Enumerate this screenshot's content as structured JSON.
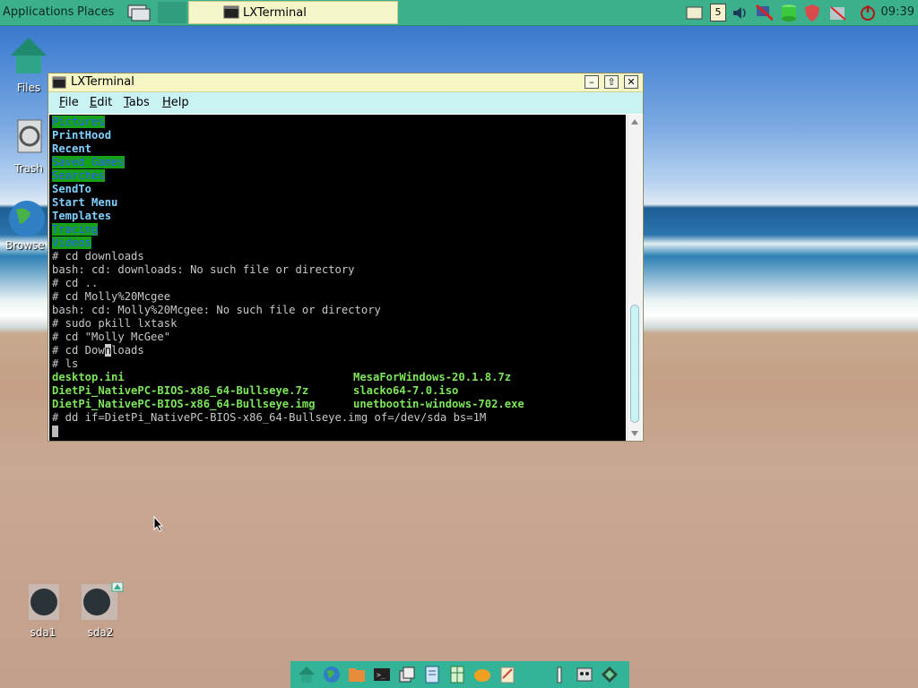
{
  "taskbar": {
    "applications": "Applications",
    "places": "Places",
    "task_title": "LXTerminal",
    "clock": "09:39",
    "calendar_day": "5"
  },
  "desktop_icons": {
    "files": "Files",
    "trash": "Trash",
    "browser": "Browse",
    "sda1": "sda1",
    "sda2": "sda2"
  },
  "window": {
    "title": "LXTerminal",
    "minimize": "–",
    "maximize": "⇧",
    "close": "✕"
  },
  "menu": {
    "file_u": "F",
    "file_rest": "ile",
    "edit_u": "E",
    "edit_rest": "dit",
    "tabs_u": "T",
    "tabs_rest": "abs",
    "help_u": "H",
    "help_rest": "elp"
  },
  "terminal": {
    "l0": "Pictures",
    "l1": "PrintHood",
    "l2": "Recent",
    "l3": "Saved Games",
    "l4": "Searches",
    "l5": "SendTo",
    "l6": "Start Menu",
    "l7": "Templates",
    "l8": "Tracing",
    "l9": "Videos",
    "l10": "# cd downloads",
    "l11": "bash: cd: downloads: No such file or directory",
    "l12": "# cd ..",
    "l13": "# cd Molly%20Mcgee",
    "l14": "bash: cd: Molly%20Mcgee: No such file or directory",
    "l15": "# sudo pkill lxtask",
    "l16": "# cd \"Molly McGee\"",
    "l17a": "# cd Dow",
    "l17b": "n",
    "l17c": "loads",
    "l18": "# ls",
    "f1": "desktop.ini",
    "f2": "MesaForWindows-20.1.8.7z",
    "f3": "DietPi_NativePC-BIOS-x86_64-Bullseye.7z",
    "f4": "slacko64-7.0.iso",
    "f5": "DietPi_NativePC-BIOS-x86_64-Bullseye.img",
    "f6": "unetbootin-windows-702.exe",
    "l22": "# dd if=DietPi_NativePC-BIOS-x86_64-Bullseye.img of=/dev/sda bs=1M"
  },
  "colors": {
    "taskbar": "#3cb08d",
    "menubar": "#c9f3f3",
    "titlebar": "#f5f6c4",
    "dir_highlight": "#16a116",
    "dir_text": "#7fd1ff",
    "exec_text": "#7ee65d"
  }
}
